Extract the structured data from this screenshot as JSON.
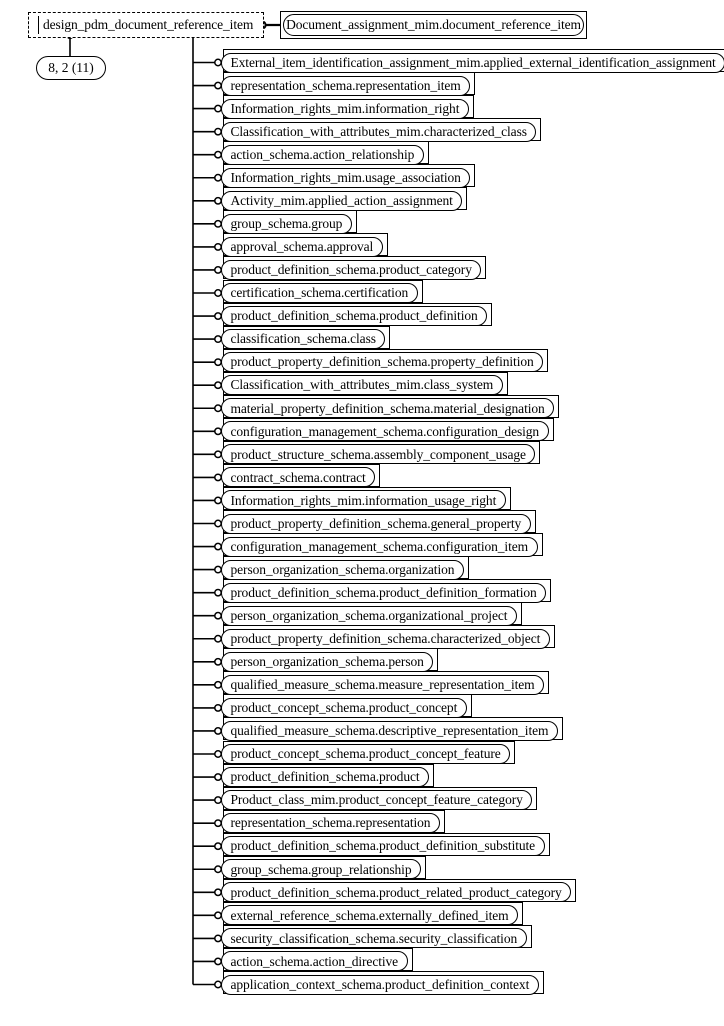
{
  "diagram": {
    "type": "express-g-entity-reference-diagram",
    "page_reference": "8, 2 (11)",
    "interface": {
      "name": "design_pdm_document_reference_item",
      "style": "dashed"
    },
    "root_entity": "Document_assignment_mim.document_reference_item",
    "entities": [
      "External_item_identification_assignment_mim.applied_external_identification_assignment",
      "representation_schema.representation_item",
      "Information_rights_mim.information_right",
      "Classification_with_attributes_mim.characterized_class",
      "action_schema.action_relationship",
      "Information_rights_mim.usage_association",
      "Activity_mim.applied_action_assignment",
      "group_schema.group",
      "approval_schema.approval",
      "product_definition_schema.product_category",
      "certification_schema.certification",
      "product_definition_schema.product_definition",
      "classification_schema.class",
      "product_property_definition_schema.property_definition",
      "Classification_with_attributes_mim.class_system",
      "material_property_definition_schema.material_designation",
      "configuration_management_schema.configuration_design",
      "product_structure_schema.assembly_component_usage",
      "contract_schema.contract",
      "Information_rights_mim.information_usage_right",
      "product_property_definition_schema.general_property",
      "configuration_management_schema.configuration_item",
      "person_organization_schema.organization",
      "product_definition_schema.product_definition_formation",
      "person_organization_schema.organizational_project",
      "product_property_definition_schema.characterized_object",
      "person_organization_schema.person",
      "qualified_measure_schema.measure_representation_item",
      "product_concept_schema.product_concept",
      "qualified_measure_schema.descriptive_representation_item",
      "product_concept_schema.product_concept_feature",
      "product_definition_schema.product",
      "Product_class_mim.product_concept_feature_category",
      "representation_schema.representation",
      "product_definition_schema.product_definition_substitute",
      "group_schema.group_relationship",
      "product_definition_schema.product_related_product_category",
      "external_reference_schema.externally_defined_item",
      "security_classification_schema.security_classification",
      "action_schema.action_directive",
      "application_context_schema.product_definition_context"
    ],
    "colors": {
      "stroke": "#000000",
      "background": "#ffffff"
    }
  }
}
